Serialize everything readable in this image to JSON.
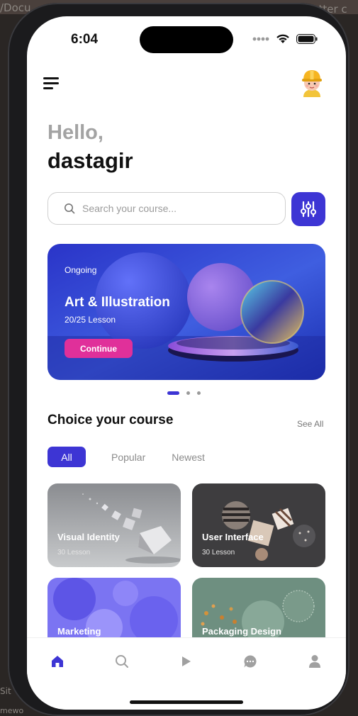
{
  "desktop": {
    "top_left_text": "/Docu",
    "top_right_text": "utter c",
    "bottom_left_text": "Sit",
    "bottom_left_text2": "mewo"
  },
  "status_bar": {
    "time": "6:04"
  },
  "header": {
    "menu_icon": "hamburger-menu-icon",
    "avatar_icon": "avatar-icon"
  },
  "greeting": {
    "hello": "Hello,",
    "name": "dastagir"
  },
  "search": {
    "placeholder": "Search your course...",
    "value": ""
  },
  "banner": {
    "tag": "Ongoing",
    "title": "Art & Illustration",
    "lessons": "20/25 Lesson",
    "button_label": "Continue",
    "carousel_total": 3,
    "carousel_active_index": 0
  },
  "courses_section": {
    "title": "Choice your course",
    "see_all": "See All",
    "filters": [
      "All",
      "Popular",
      "Newest"
    ],
    "active_filter": "All",
    "cards": [
      {
        "title": "Visual Identity",
        "lessons": "30 Lesson"
      },
      {
        "title": "User Interface",
        "lessons": "30 Lesson"
      },
      {
        "title": "Marketing",
        "lessons": ""
      },
      {
        "title": "Packaging Design",
        "lessons": ""
      }
    ]
  },
  "bottom_nav": {
    "items": [
      "home-icon",
      "search-icon",
      "play-icon",
      "chat-icon",
      "profile-icon"
    ],
    "active": "home-icon"
  },
  "colors": {
    "accent": "#3d35d4",
    "continue_button": "#e0309a",
    "greeting_muted": "#a3a3a3"
  }
}
